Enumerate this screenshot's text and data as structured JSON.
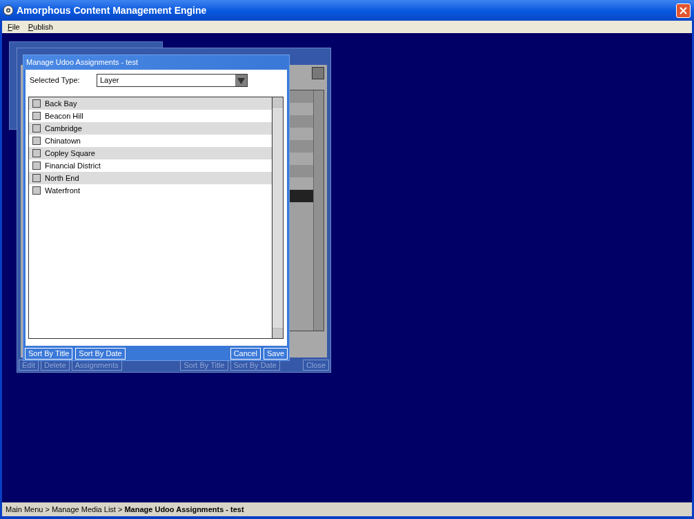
{
  "window": {
    "title": "Amorphous Content Management Engine"
  },
  "menu": [
    {
      "mnemonic": "F",
      "rest": "ile"
    },
    {
      "mnemonic": "P",
      "rest": "ublish"
    }
  ],
  "background_window": {
    "buttons_left": [
      "Edit",
      "Delete",
      "Assignments"
    ],
    "buttons_right": [
      "Sort By Title",
      "Sort By Date"
    ],
    "close": "Close"
  },
  "dialog": {
    "title": "Manage Udoo Assignments - test",
    "type_label": "Selected Type:",
    "type_value": "Layer",
    "items": [
      {
        "label": "Back Bay",
        "checked": false
      },
      {
        "label": "Beacon Hill",
        "checked": false
      },
      {
        "label": "Cambridge",
        "checked": false
      },
      {
        "label": "Chinatown",
        "checked": false
      },
      {
        "label": "Copley Square",
        "checked": false
      },
      {
        "label": "Financial District",
        "checked": false
      },
      {
        "label": "North End",
        "checked": false
      },
      {
        "label": "Waterfront",
        "checked": false
      }
    ],
    "buttons_left": [
      "Sort By Title",
      "Sort By Date"
    ],
    "buttons_right": [
      "Cancel",
      "Save"
    ]
  },
  "status_bar": {
    "path": "Main Menu > Manage Media List > **Manage Udoo Assignments - test**"
  }
}
